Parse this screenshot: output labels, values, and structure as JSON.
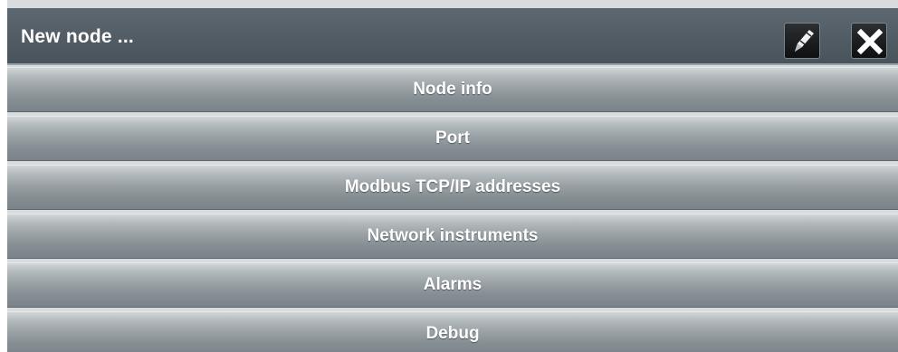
{
  "window": {
    "title": "New node ..."
  },
  "toolbar": {
    "edit_icon": "pencil-icon",
    "close_icon": "close-icon"
  },
  "sections": [
    {
      "label": "Node info"
    },
    {
      "label": "Port"
    },
    {
      "label": "Modbus TCP/IP addresses"
    },
    {
      "label": "Network instruments"
    },
    {
      "label": "Alarms"
    },
    {
      "label": "Debug"
    }
  ],
  "colors": {
    "titlebar": "#505b63",
    "section": "#9aa2a6",
    "text": "#ffffff"
  }
}
